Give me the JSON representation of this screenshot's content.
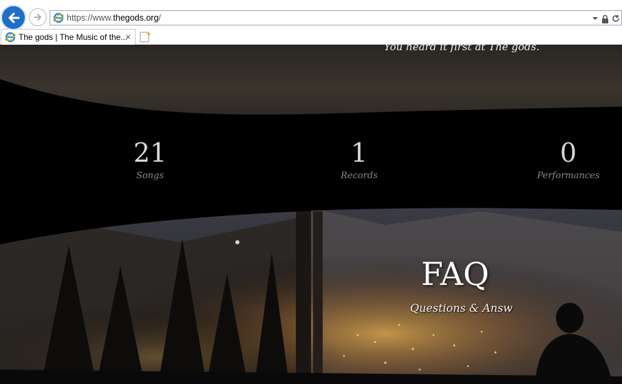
{
  "browser": {
    "url_prefix": "https://www.",
    "url_domain": "thegods.org",
    "url_suffix": "/",
    "tab_title": "The gods | The Music of the...",
    "tab_close": "×"
  },
  "hero": {
    "tagline": "You heard it first at The gods."
  },
  "stats": [
    {
      "value": "21",
      "label": "Songs"
    },
    {
      "value": "1",
      "label": "Records"
    },
    {
      "value": "0",
      "label": "Performances"
    }
  ],
  "faq": {
    "title": "FAQ",
    "subtitle": "Questions & Answ"
  },
  "colors": {
    "back_button": "#1e6fc5",
    "page_background": "#000000"
  }
}
